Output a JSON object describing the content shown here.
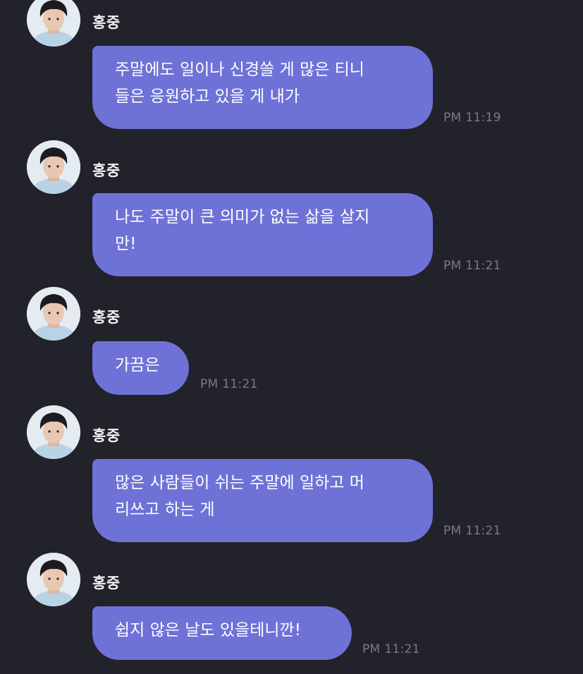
{
  "theme": {
    "background": "#22222a",
    "bubble_color": "#6e72d7",
    "text_color": "#ffffff",
    "time_color": "#7a7a82"
  },
  "messages": [
    {
      "sender": "홍중",
      "avatar_icon": "profile-photo-avatar",
      "text": "주말에도 일이나 신경쓸 게 많은 티니\n들은 응원하고 있을 게 내가",
      "time": "PM 11:19"
    },
    {
      "sender": "홍중",
      "avatar_icon": "profile-photo-avatar",
      "text": "나도 주말이 큰 의미가 없는 삶을 살지\n만!",
      "time": "PM 11:21"
    },
    {
      "sender": "홍중",
      "avatar_icon": "profile-photo-avatar",
      "text": "가끔은",
      "time": "PM 11:21"
    },
    {
      "sender": "홍중",
      "avatar_icon": "profile-photo-avatar",
      "text": "많은 사람들이 쉬는 주말에 일하고 머\n리쓰고 하는 게",
      "time": "PM 11:21"
    },
    {
      "sender": "홍중",
      "avatar_icon": "profile-photo-avatar",
      "text": "쉽지 않은 날도 있을테니깐!",
      "time": "PM 11:21"
    }
  ]
}
